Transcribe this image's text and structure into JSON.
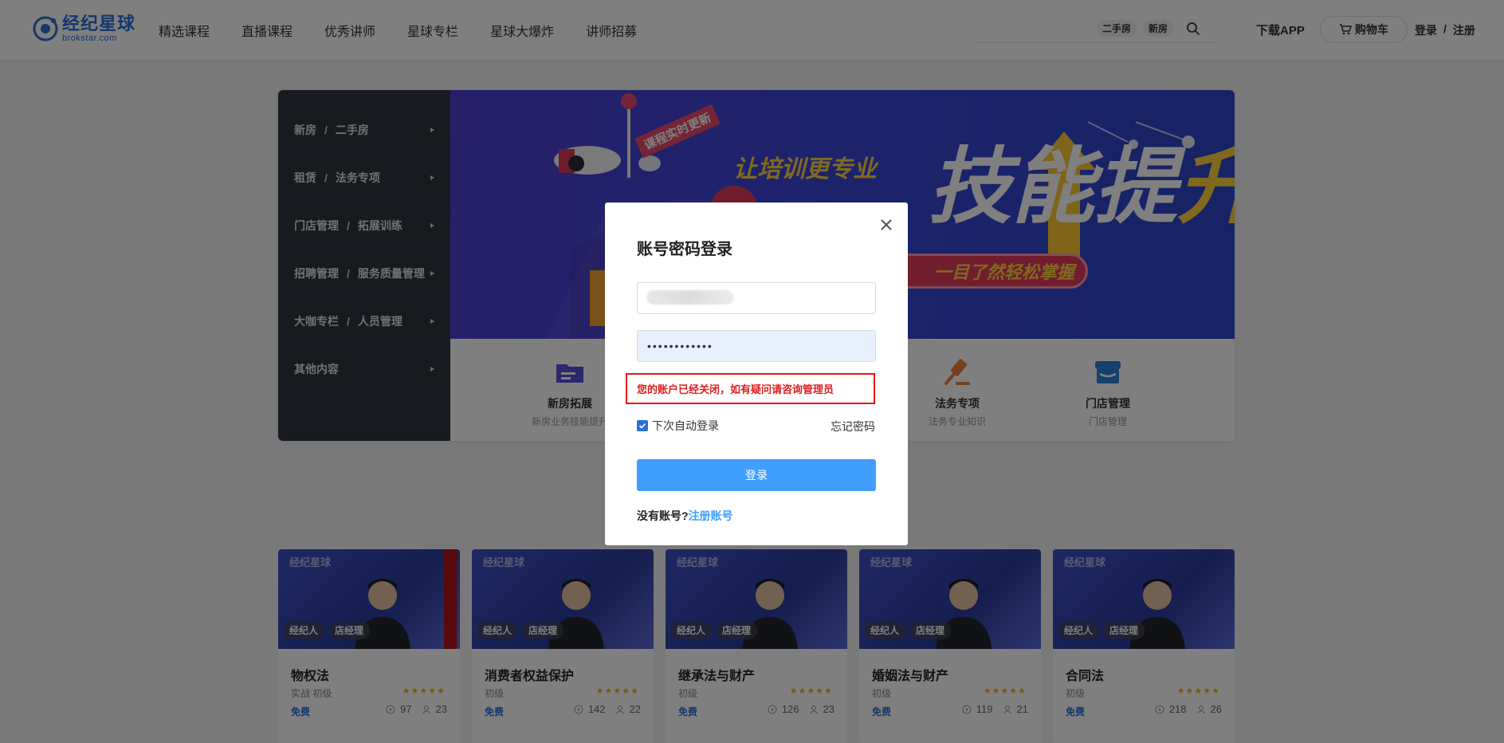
{
  "header": {
    "logo_cn": "经纪星球",
    "logo_en": "brokstar.com",
    "nav": [
      "精选课程",
      "直播课程",
      "优秀讲师",
      "星球专栏",
      "星球大爆炸",
      "讲师招募"
    ],
    "search_tags": [
      "二手房",
      "新房"
    ],
    "download_app": "下载APP",
    "cart": "购物车",
    "login": "登录",
    "separator": "/",
    "register": "注册"
  },
  "sidebar": {
    "items": [
      {
        "a": "新房",
        "b": "二手房"
      },
      {
        "a": "租赁",
        "b": "法务专项"
      },
      {
        "a": "门店管理",
        "b": "拓展训练"
      },
      {
        "a": "招聘管理",
        "b": "服务质量管理"
      },
      {
        "a": "大咖专栏",
        "b": "人员管理"
      },
      {
        "a": "其他内容",
        "b": ""
      }
    ],
    "separator": "/"
  },
  "banner": {
    "tag": "课程实时更新",
    "slogan_small": "让培训更专业",
    "slogan_big_1": "技能提",
    "slogan_big_2": "升",
    "pill": "一目了然轻松掌握"
  },
  "quick_categories": [
    {
      "title": "新房拓展",
      "sub": "新房业务技能提升",
      "color": "#5b4fd6"
    },
    {
      "title": "法务专项",
      "sub": "法务专业知识",
      "color": "#e8833a"
    },
    {
      "title": "门店管理",
      "sub": "门店管理",
      "color": "#2a7ed8"
    }
  ],
  "courses": [
    {
      "title": "物权法",
      "level": "实战  初级",
      "price": "免费",
      "views": "97",
      "learners": "23",
      "tag1": "经纪人",
      "tag2": "店经理",
      "thumb_logo": "经纪星球"
    },
    {
      "title": "消费者权益保护",
      "level": "初级",
      "price": "免费",
      "views": "142",
      "learners": "22",
      "tag1": "经纪人",
      "tag2": "店经理",
      "thumb_logo": "经纪星球"
    },
    {
      "title": "继承法与财产",
      "level": "初级",
      "price": "免费",
      "views": "126",
      "learners": "23",
      "tag1": "经纪人",
      "tag2": "店经理",
      "thumb_logo": "经纪星球"
    },
    {
      "title": "婚姻法与财产",
      "level": "初级",
      "price": "免费",
      "views": "119",
      "learners": "21",
      "tag1": "经纪人",
      "tag2": "店经理",
      "thumb_logo": "经纪星球"
    },
    {
      "title": "合同法",
      "level": "初级",
      "price": "免费",
      "views": "218",
      "learners": "26",
      "tag1": "经纪人",
      "tag2": "店经理",
      "thumb_logo": "经纪星球"
    }
  ],
  "stars": "★★★★★",
  "modal": {
    "title": "账号密码登录",
    "username_value": "",
    "password_value": "••••••••••••",
    "error": "您的账户已经关闭，如有疑问请咨询管理员",
    "remember": "下次自动登录",
    "forgot": "忘记密码",
    "login_button": "登录",
    "no_account": "没有账号?",
    "register_link": "注册账号"
  },
  "colors": {
    "brand": "#2a6fd8",
    "primary_button": "#409eff",
    "error": "#e02020",
    "sidebar_bg": "#2f3640"
  }
}
